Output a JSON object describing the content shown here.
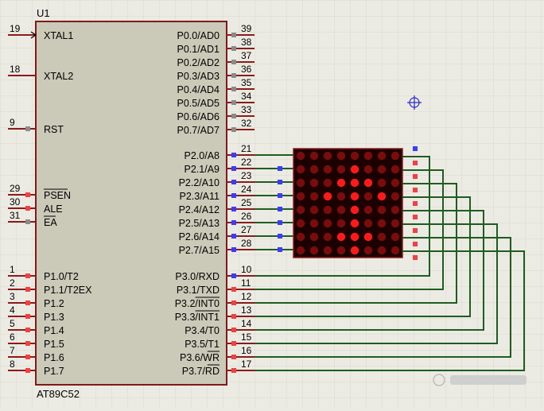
{
  "chip": {
    "ref": "U1",
    "part": "AT89C52",
    "left_pins": [
      {
        "num": "19",
        "name": "XTAL1",
        "marker": "arrow"
      },
      {
        "num": "18",
        "name": "XTAL2",
        "marker": "none"
      },
      {
        "num": "9",
        "name": "RST",
        "marker": "gray"
      },
      {
        "num": "29",
        "name": "PSEN",
        "marker": "red",
        "overline": true
      },
      {
        "num": "30",
        "name": "ALE",
        "marker": "red",
        "overline": false
      },
      {
        "num": "31",
        "name": "EA",
        "marker": "gray",
        "overline": true
      },
      {
        "num": "1",
        "name": "P1.0/T2",
        "marker": "red"
      },
      {
        "num": "2",
        "name": "P1.1/T2EX",
        "marker": "red"
      },
      {
        "num": "3",
        "name": "P1.2",
        "marker": "red"
      },
      {
        "num": "4",
        "name": "P1.3",
        "marker": "red"
      },
      {
        "num": "5",
        "name": "P1.4",
        "marker": "red"
      },
      {
        "num": "6",
        "name": "P1.5",
        "marker": "red"
      },
      {
        "num": "7",
        "name": "P1.6",
        "marker": "red"
      },
      {
        "num": "8",
        "name": "P1.7",
        "marker": "red"
      }
    ],
    "right_pins": [
      {
        "num": "39",
        "name": "P0.0/AD0",
        "marker": "gray"
      },
      {
        "num": "38",
        "name": "P0.1/AD1",
        "marker": "gray"
      },
      {
        "num": "37",
        "name": "P0.2/AD2",
        "marker": "gray"
      },
      {
        "num": "36",
        "name": "P0.3/AD3",
        "marker": "gray"
      },
      {
        "num": "35",
        "name": "P0.4/AD4",
        "marker": "gray"
      },
      {
        "num": "34",
        "name": "P0.5/AD5",
        "marker": "gray"
      },
      {
        "num": "33",
        "name": "P0.6/AD6",
        "marker": "gray"
      },
      {
        "num": "32",
        "name": "P0.7/AD7",
        "marker": "gray"
      },
      {
        "num": "21",
        "name": "P2.0/A8",
        "marker": "blue"
      },
      {
        "num": "22",
        "name": "P2.1/A9",
        "marker": "blue"
      },
      {
        "num": "23",
        "name": "P2.2/A10",
        "marker": "blue"
      },
      {
        "num": "24",
        "name": "P2.3/A11",
        "marker": "blue"
      },
      {
        "num": "25",
        "name": "P2.4/A12",
        "marker": "blue"
      },
      {
        "num": "26",
        "name": "P2.5/A13",
        "marker": "blue"
      },
      {
        "num": "27",
        "name": "P2.6/A14",
        "marker": "blue"
      },
      {
        "num": "28",
        "name": "P2.7/A15",
        "marker": "blue"
      },
      {
        "num": "10",
        "name": "P3.0/RXD",
        "marker": "blue"
      },
      {
        "num": "11",
        "name": "P3.1/TXD",
        "marker": "red"
      },
      {
        "num": "12",
        "name": "P3.2/INT0",
        "marker": "red",
        "overline_part": "INT0"
      },
      {
        "num": "13",
        "name": "P3.3/INT1",
        "marker": "red",
        "overline_part": "INT1"
      },
      {
        "num": "14",
        "name": "P3.4/T0",
        "marker": "red"
      },
      {
        "num": "15",
        "name": "P3.5/T1",
        "marker": "red"
      },
      {
        "num": "16",
        "name": "P3.6/WR",
        "marker": "red",
        "overline_part": "WR"
      },
      {
        "num": "17",
        "name": "P3.7/RD",
        "marker": "red",
        "overline_part": "RD"
      }
    ]
  },
  "matrix": {
    "rows": 8,
    "cols": 8,
    "lit": [
      [
        0,
        0,
        0,
        0,
        0,
        0,
        0,
        0
      ],
      [
        0,
        0,
        0,
        0,
        1,
        0,
        0,
        0
      ],
      [
        0,
        0,
        0,
        1,
        1,
        1,
        0,
        0
      ],
      [
        0,
        0,
        1,
        0,
        1,
        0,
        1,
        0
      ],
      [
        0,
        0,
        0,
        0,
        1,
        0,
        0,
        0
      ],
      [
        0,
        0,
        0,
        0,
        1,
        0,
        0,
        0
      ],
      [
        0,
        0,
        0,
        1,
        1,
        1,
        0,
        0
      ],
      [
        0,
        0,
        0,
        0,
        1,
        0,
        0,
        0
      ]
    ]
  },
  "colors": {
    "background": "#ecebe3",
    "grid": "#d9d8cf",
    "chip_body": "#cbc9b7",
    "chip_border": "#7f1a1a",
    "pin_line": "#8b1a1a",
    "wire": "#1f5c1f",
    "led_on": "#ff1a1a",
    "led_off": "#7a0c0c",
    "marker_red": "#f04040",
    "marker_blue": "#3b3bff",
    "marker_gray": "#8a8a8a"
  }
}
